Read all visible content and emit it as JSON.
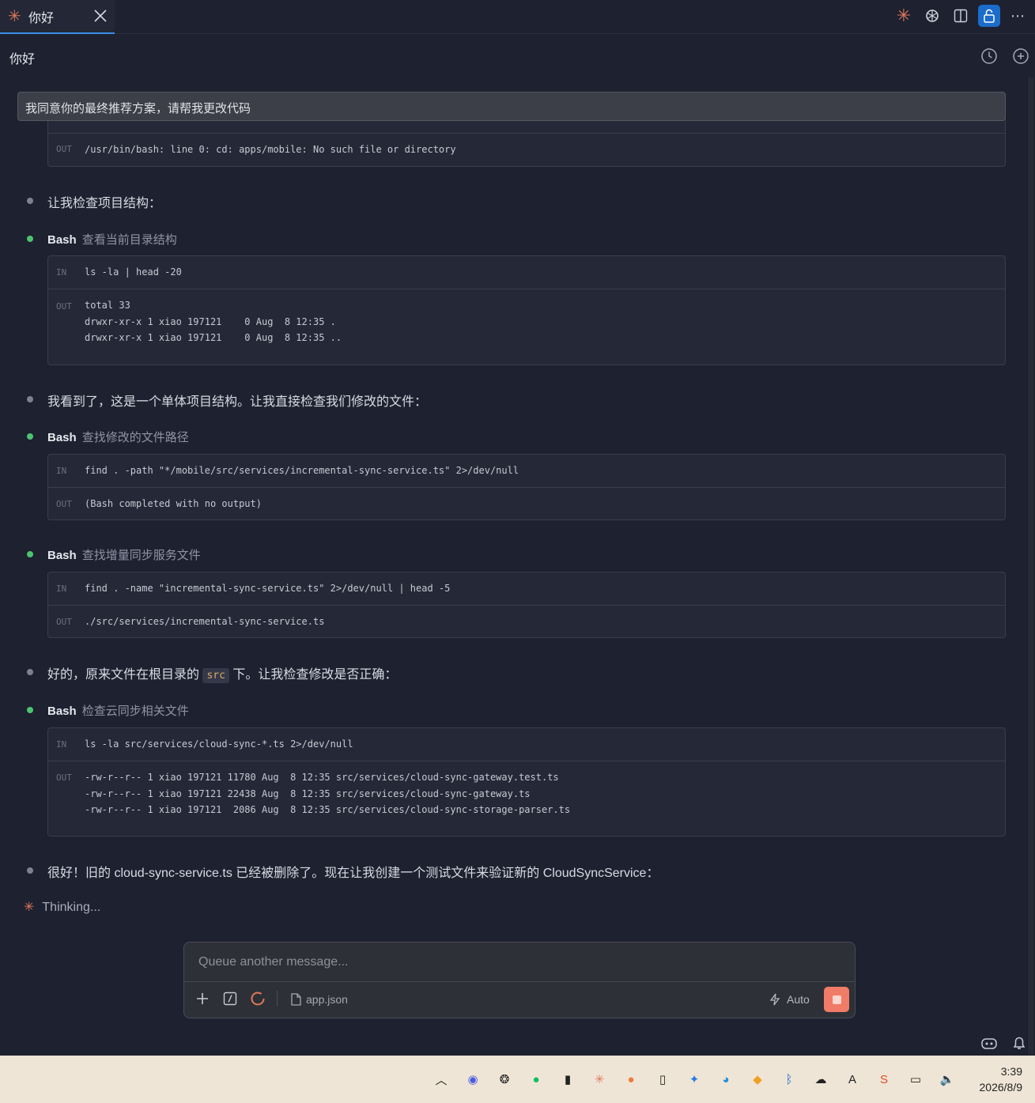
{
  "tab": {
    "title": "你好"
  },
  "header": {
    "title": "你好"
  },
  "sticky_user_message": "我同意你的最终推荐方案，请帮我更改代码",
  "messages": [
    {
      "type": "text",
      "text": "让我检查项目结构："
    },
    {
      "type": "text",
      "text": "我看到了，这是一个单体项目结构。让我直接检查我们修改的文件："
    },
    {
      "type": "text_prefix",
      "text": "好的，原来文件在根目录的"
    },
    {
      "type": "text_suffix",
      "text": "下。让我检查修改是否正确："
    },
    {
      "type": "text",
      "text": "很好！旧的 cloud-sync-service.ts 已经被删除了。现在让我创建一个测试文件来验证新的 CloudSyncService："
    }
  ],
  "inline_code": "src",
  "tools": [
    {
      "name": "Bash",
      "desc": "查看当前目录结构",
      "in": "ls -la | head -20",
      "out": "total 33\ndrwxr-xr-x 1 xiao 197121    0 Aug  8 12:35 .\ndrwxr-xr-x 1 xiao 197121    0 Aug  8 12:35 .."
    },
    {
      "name": "Bash",
      "desc": "查找修改的文件路径",
      "in": "find . -path \"*/mobile/src/services/incremental-sync-service.ts\" 2>/dev/null",
      "out": "(Bash completed with no output)"
    },
    {
      "name": "Bash",
      "desc": "查找增量同步服务文件",
      "in": "find . -name \"incremental-sync-service.ts\" 2>/dev/null | head -5",
      "out": "./src/services/incremental-sync-service.ts"
    },
    {
      "name": "Bash",
      "desc": "检查云同步相关文件",
      "in": "ls -la src/services/cloud-sync-*.ts 2>/dev/null",
      "out": "-rw-r--r-- 1 xiao 197121 11780 Aug  8 12:35 src/services/cloud-sync-gateway.test.ts\n-rw-r--r-- 1 xiao 197121 22438 Aug  8 12:35 src/services/cloud-sync-gateway.ts\n-rw-r--r-- 1 xiao 197121  2086 Aug  8 12:35 src/services/cloud-sync-storage-parser.ts"
    }
  ],
  "first_out": "/usr/bin/bash: line 0: cd: apps/mobile: No such file or directory",
  "labels": {
    "in": "IN",
    "out": "OUT"
  },
  "thinking": "Thinking...",
  "composer": {
    "placeholder": "Queue another message...",
    "attachment": "app.json",
    "mode": "Auto"
  },
  "clock": {
    "time": "3:39",
    "date": "2026/8/9"
  },
  "colors": {
    "accent": "#e0785a",
    "bullet_green": "#4cc46e",
    "bg": "#1e2130",
    "stop": "#f07b66"
  }
}
